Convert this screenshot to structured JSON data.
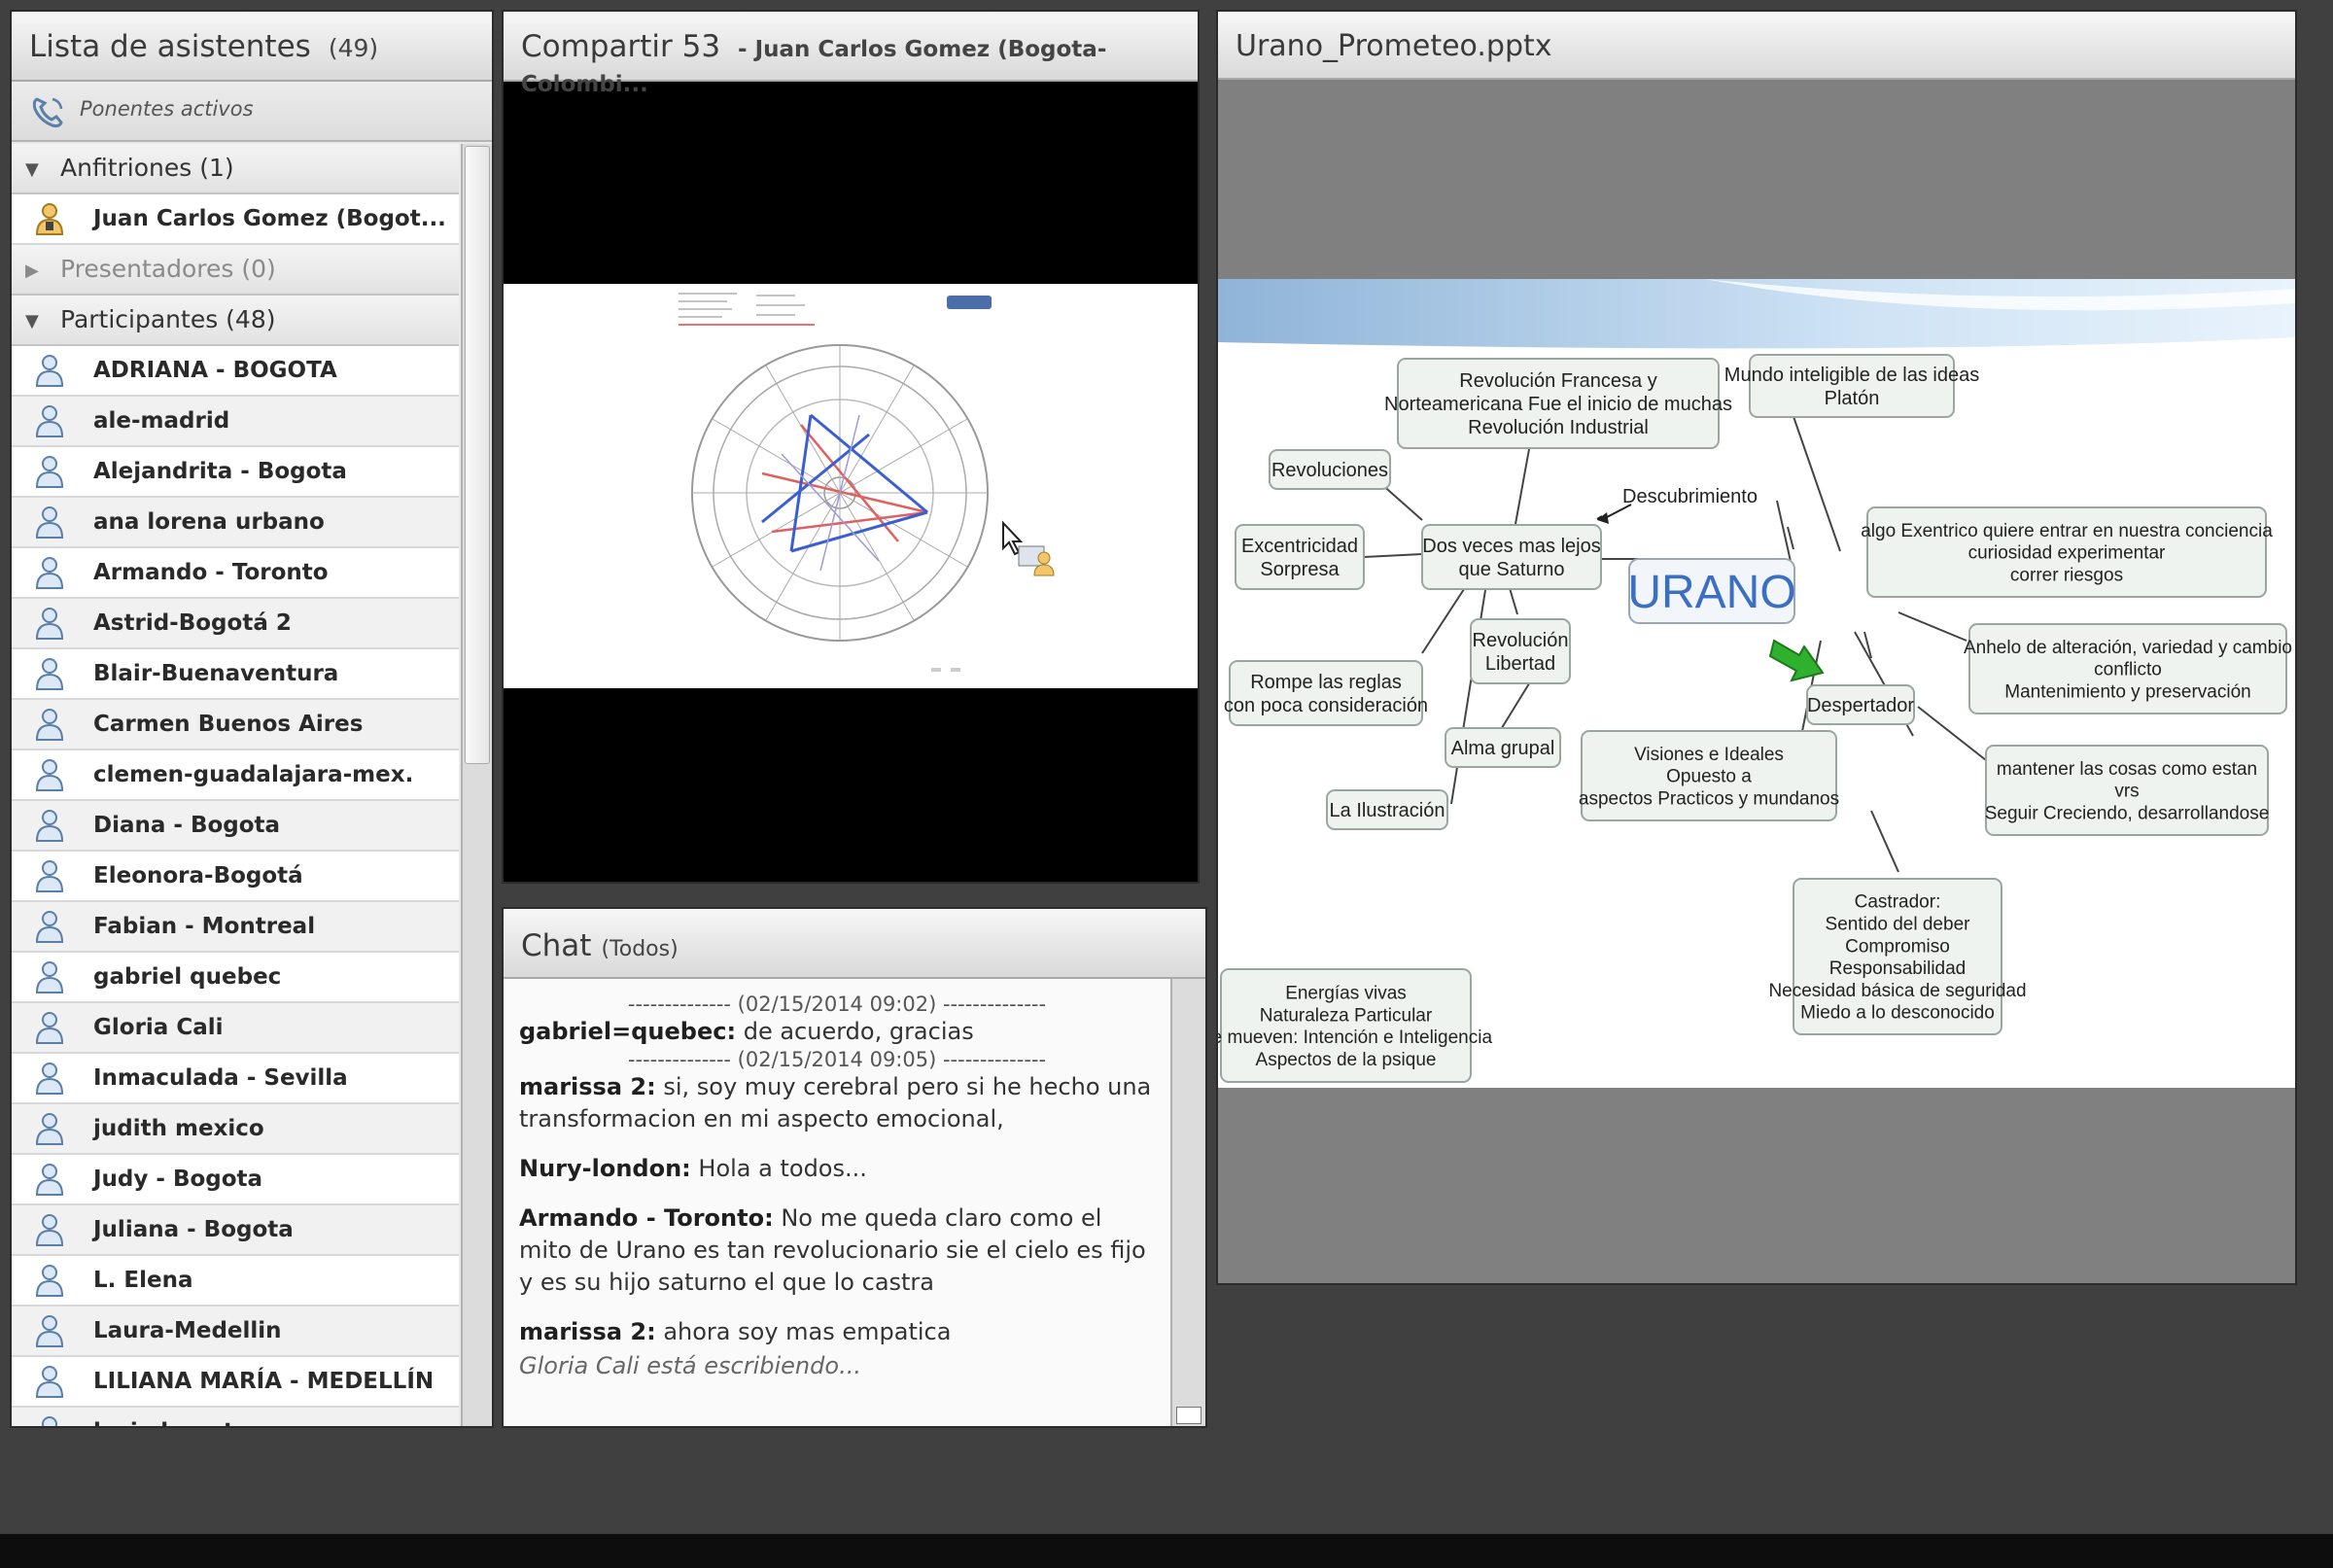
{
  "attendees": {
    "title": "Lista de asistentes",
    "count": "(49)",
    "active_speakers": "Ponentes activos",
    "hosts": {
      "label": "Anfitriones (1)",
      "items": [
        "Juan Carlos Gomez (Bogot..."
      ]
    },
    "presenters": {
      "label": "Presentadores (0)"
    },
    "participants": {
      "label": "Participantes (48)",
      "items": [
        "ADRIANA - BOGOTA",
        "ale-madrid",
        "Alejandrita - Bogota",
        "ana lorena urbano",
        "Armando - Toronto",
        "Astrid-Bogotá 2",
        "Blair-Buenaventura",
        "Carmen Buenos Aires",
        "clemen-guadalajara-mex.",
        "Diana - Bogota",
        "Eleonora-Bogotá",
        "Fabian - Montreal",
        "gabriel quebec",
        "Gloria Cali",
        "Inmaculada - Sevilla",
        "judith mexico",
        "Judy - Bogota",
        "Juliana - Bogota",
        "L. Elena",
        "Laura-Medellin",
        "LILIANA MARÍA - MEDELLÍN",
        "lucia bogota"
      ]
    }
  },
  "share": {
    "title": "Compartir 53",
    "subtitle": "- Juan Carlos Gomez (Bogota-Colombi..."
  },
  "chat": {
    "title": "Chat",
    "scope": "(Todos)",
    "sep1": "-------------- (02/15/2014 09:02) --------------",
    "sep2": "-------------- (02/15/2014 09:05) --------------",
    "messages": [
      {
        "sender": "gabriel=quebec:",
        "text": "de acuerdo, gracias"
      },
      {
        "sender": "marissa 2:",
        "text": "si, soy muy cerebral pero si he hecho una transformacion en mi aspecto emocional,"
      },
      {
        "sender": "Nury-london:",
        "text": "Hola a todos..."
      },
      {
        "sender": "Armando - Toronto:",
        "text": "No me queda claro como el mito de Urano es tan revolucionario sie el cielo es  fijo y es su hijo saturno el que lo castra"
      },
      {
        "sender": "marissa 2:",
        "text": "ahora soy mas empatica"
      }
    ],
    "typing": "Gloria Cali está escribiendo..."
  },
  "slide": {
    "title": "Urano_Prometeo.pptx",
    "center": "URANO",
    "nodes": {
      "revfrancesa": [
        "Revolución Francesa y",
        "Norteamericana Fue el inicio de muchas",
        "Revolución Industrial"
      ],
      "mundo": [
        "Mundo inteligible de las ideas",
        "Platón"
      ],
      "revoluciones": [
        "Revoluciones"
      ],
      "descubrimiento": "Descubrimiento",
      "excentricidad": [
        "Excentricidad",
        "Sorpresa"
      ],
      "dosveces": [
        "Dos veces mas lejos",
        "que Saturno"
      ],
      "algo": [
        "algo Exentrico quiere entrar en nuestra conciencia",
        "curiosidad experimentar",
        "correr riesgos"
      ],
      "revlibertad": [
        "Revolución",
        "Libertad"
      ],
      "anhelo": [
        "Anhelo de alteración, variedad y cambio",
        "conflicto",
        "Mantenimiento y preservación"
      ],
      "rompe": [
        "Rompe las reglas",
        "con poca consideración"
      ],
      "despertador": [
        "Despertador"
      ],
      "alma": [
        "Alma grupal"
      ],
      "visiones": [
        "Visiones e Ideales",
        "Opuesto a",
        "aspectos Practicos y mundanos"
      ],
      "mantener": [
        "mantener las cosas como estan",
        "vrs",
        "Seguir Creciendo, desarrollandose"
      ],
      "ilustracion": [
        "La Ilustración"
      ],
      "castrador": [
        "Castrador:",
        "Sentido del deber",
        "Compromiso",
        "Responsabilidad",
        "Necesidad básica de seguridad",
        "Miedo a lo desconocido"
      ],
      "energias": [
        "Energías vivas",
        "Naturaleza Particular",
        "Se mueven: Intención e Inteligencia",
        "Aspectos de la psique"
      ]
    }
  },
  "colors": {
    "accent_blue": "#3a6fc2",
    "arrow_green": "#2fb12f"
  }
}
